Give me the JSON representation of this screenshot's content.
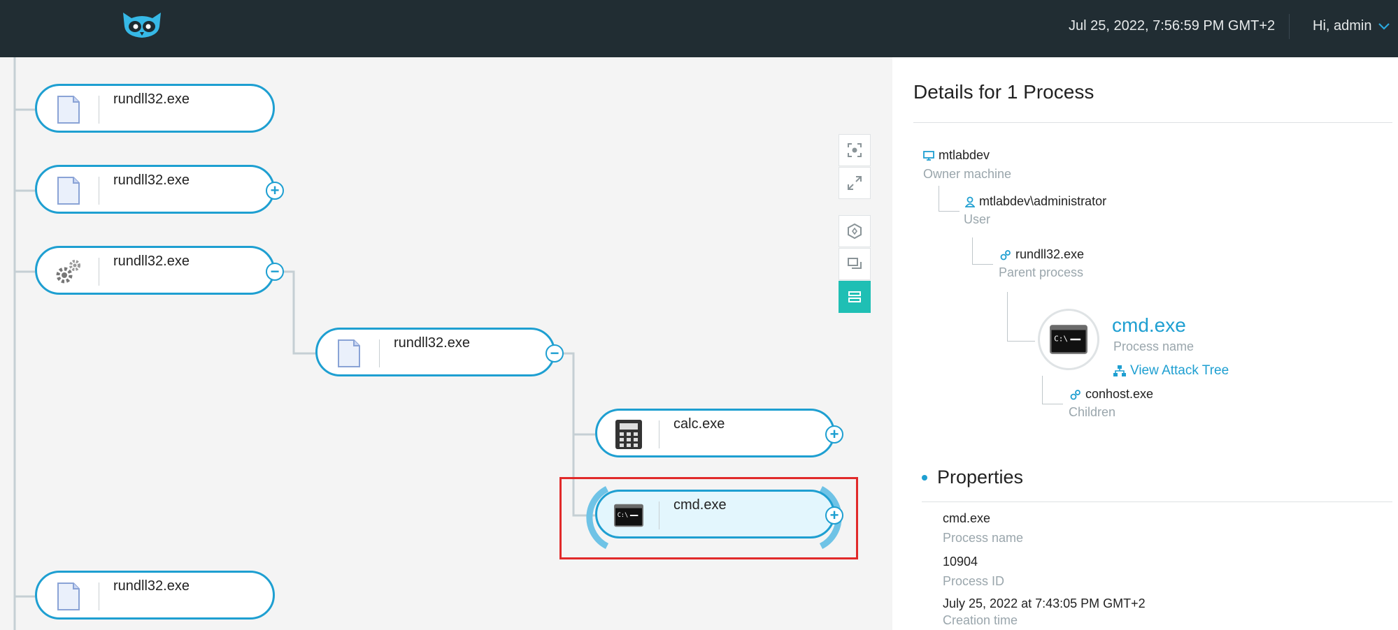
{
  "topbar": {
    "datetime": "Jul 25, 2022, 7:56:59 PM GMT+2",
    "user_greeting": "Hi, admin"
  },
  "tree": {
    "nodes": [
      {
        "label": "rundll32.exe",
        "icon": "document-icon",
        "toggle": "none"
      },
      {
        "label": "rundll32.exe",
        "icon": "document-icon",
        "toggle": "+"
      },
      {
        "label": "rundll32.exe",
        "icon": "gears-icon",
        "toggle": "−"
      },
      {
        "label": "rundll32.exe",
        "icon": "document-icon",
        "toggle": "−"
      },
      {
        "label": "calc.exe",
        "icon": "calculator-icon",
        "toggle": "+"
      },
      {
        "label": "cmd.exe",
        "icon": "terminal-icon",
        "toggle": "+",
        "selected": true
      },
      {
        "label": "rundll32.exe",
        "icon": "document-icon",
        "toggle": "none"
      }
    ],
    "tools": [
      "focus-icon",
      "expand-icon",
      "hexagon-icon",
      "windows-icon",
      "list-view-icon"
    ]
  },
  "details": {
    "title": "Details for 1 Process",
    "machine": {
      "value": "mtlabdev",
      "caption": "Owner machine"
    },
    "user": {
      "value": "mtlabdev\\administrator",
      "caption": "User"
    },
    "parent": {
      "value": "rundll32.exe",
      "caption": "Parent process"
    },
    "process": {
      "name": "cmd.exe",
      "caption": "Process name",
      "link": "View Attack Tree"
    },
    "children": {
      "value": "conhost.exe",
      "caption": "Children"
    }
  },
  "properties": {
    "heading": "Properties",
    "items": [
      {
        "value": "cmd.exe",
        "caption": "Process name"
      },
      {
        "value": "10904",
        "caption": "Process ID"
      },
      {
        "value": "July 25, 2022 at 7:43:05 PM GMT+2",
        "caption": "Creation time"
      }
    ]
  },
  "colors": {
    "accent": "#1e9fd1",
    "topbar": "#212d33",
    "active_tool": "#1fbfb4",
    "highlight": "#e12a2a"
  }
}
